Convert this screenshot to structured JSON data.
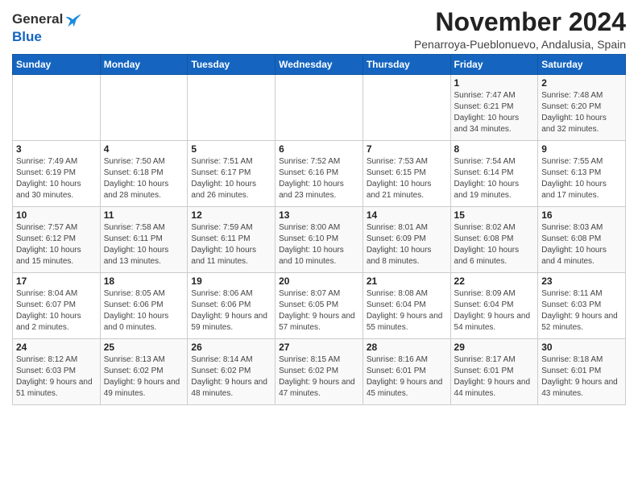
{
  "logo": {
    "general": "General",
    "blue": "Blue"
  },
  "title": "November 2024",
  "subtitle": "Penarroya-Pueblonuevo, Andalusia, Spain",
  "days_of_week": [
    "Sunday",
    "Monday",
    "Tuesday",
    "Wednesday",
    "Thursday",
    "Friday",
    "Saturday"
  ],
  "weeks": [
    [
      {
        "day": "",
        "info": ""
      },
      {
        "day": "",
        "info": ""
      },
      {
        "day": "",
        "info": ""
      },
      {
        "day": "",
        "info": ""
      },
      {
        "day": "",
        "info": ""
      },
      {
        "day": "1",
        "info": "Sunrise: 7:47 AM\nSunset: 6:21 PM\nDaylight: 10 hours and 34 minutes."
      },
      {
        "day": "2",
        "info": "Sunrise: 7:48 AM\nSunset: 6:20 PM\nDaylight: 10 hours and 32 minutes."
      }
    ],
    [
      {
        "day": "3",
        "info": "Sunrise: 7:49 AM\nSunset: 6:19 PM\nDaylight: 10 hours and 30 minutes."
      },
      {
        "day": "4",
        "info": "Sunrise: 7:50 AM\nSunset: 6:18 PM\nDaylight: 10 hours and 28 minutes."
      },
      {
        "day": "5",
        "info": "Sunrise: 7:51 AM\nSunset: 6:17 PM\nDaylight: 10 hours and 26 minutes."
      },
      {
        "day": "6",
        "info": "Sunrise: 7:52 AM\nSunset: 6:16 PM\nDaylight: 10 hours and 23 minutes."
      },
      {
        "day": "7",
        "info": "Sunrise: 7:53 AM\nSunset: 6:15 PM\nDaylight: 10 hours and 21 minutes."
      },
      {
        "day": "8",
        "info": "Sunrise: 7:54 AM\nSunset: 6:14 PM\nDaylight: 10 hours and 19 minutes."
      },
      {
        "day": "9",
        "info": "Sunrise: 7:55 AM\nSunset: 6:13 PM\nDaylight: 10 hours and 17 minutes."
      }
    ],
    [
      {
        "day": "10",
        "info": "Sunrise: 7:57 AM\nSunset: 6:12 PM\nDaylight: 10 hours and 15 minutes."
      },
      {
        "day": "11",
        "info": "Sunrise: 7:58 AM\nSunset: 6:11 PM\nDaylight: 10 hours and 13 minutes."
      },
      {
        "day": "12",
        "info": "Sunrise: 7:59 AM\nSunset: 6:11 PM\nDaylight: 10 hours and 11 minutes."
      },
      {
        "day": "13",
        "info": "Sunrise: 8:00 AM\nSunset: 6:10 PM\nDaylight: 10 hours and 10 minutes."
      },
      {
        "day": "14",
        "info": "Sunrise: 8:01 AM\nSunset: 6:09 PM\nDaylight: 10 hours and 8 minutes."
      },
      {
        "day": "15",
        "info": "Sunrise: 8:02 AM\nSunset: 6:08 PM\nDaylight: 10 hours and 6 minutes."
      },
      {
        "day": "16",
        "info": "Sunrise: 8:03 AM\nSunset: 6:08 PM\nDaylight: 10 hours and 4 minutes."
      }
    ],
    [
      {
        "day": "17",
        "info": "Sunrise: 8:04 AM\nSunset: 6:07 PM\nDaylight: 10 hours and 2 minutes."
      },
      {
        "day": "18",
        "info": "Sunrise: 8:05 AM\nSunset: 6:06 PM\nDaylight: 10 hours and 0 minutes."
      },
      {
        "day": "19",
        "info": "Sunrise: 8:06 AM\nSunset: 6:06 PM\nDaylight: 9 hours and 59 minutes."
      },
      {
        "day": "20",
        "info": "Sunrise: 8:07 AM\nSunset: 6:05 PM\nDaylight: 9 hours and 57 minutes."
      },
      {
        "day": "21",
        "info": "Sunrise: 8:08 AM\nSunset: 6:04 PM\nDaylight: 9 hours and 55 minutes."
      },
      {
        "day": "22",
        "info": "Sunrise: 8:09 AM\nSunset: 6:04 PM\nDaylight: 9 hours and 54 minutes."
      },
      {
        "day": "23",
        "info": "Sunrise: 8:11 AM\nSunset: 6:03 PM\nDaylight: 9 hours and 52 minutes."
      }
    ],
    [
      {
        "day": "24",
        "info": "Sunrise: 8:12 AM\nSunset: 6:03 PM\nDaylight: 9 hours and 51 minutes."
      },
      {
        "day": "25",
        "info": "Sunrise: 8:13 AM\nSunset: 6:02 PM\nDaylight: 9 hours and 49 minutes."
      },
      {
        "day": "26",
        "info": "Sunrise: 8:14 AM\nSunset: 6:02 PM\nDaylight: 9 hours and 48 minutes."
      },
      {
        "day": "27",
        "info": "Sunrise: 8:15 AM\nSunset: 6:02 PM\nDaylight: 9 hours and 47 minutes."
      },
      {
        "day": "28",
        "info": "Sunrise: 8:16 AM\nSunset: 6:01 PM\nDaylight: 9 hours and 45 minutes."
      },
      {
        "day": "29",
        "info": "Sunrise: 8:17 AM\nSunset: 6:01 PM\nDaylight: 9 hours and 44 minutes."
      },
      {
        "day": "30",
        "info": "Sunrise: 8:18 AM\nSunset: 6:01 PM\nDaylight: 9 hours and 43 minutes."
      }
    ]
  ]
}
